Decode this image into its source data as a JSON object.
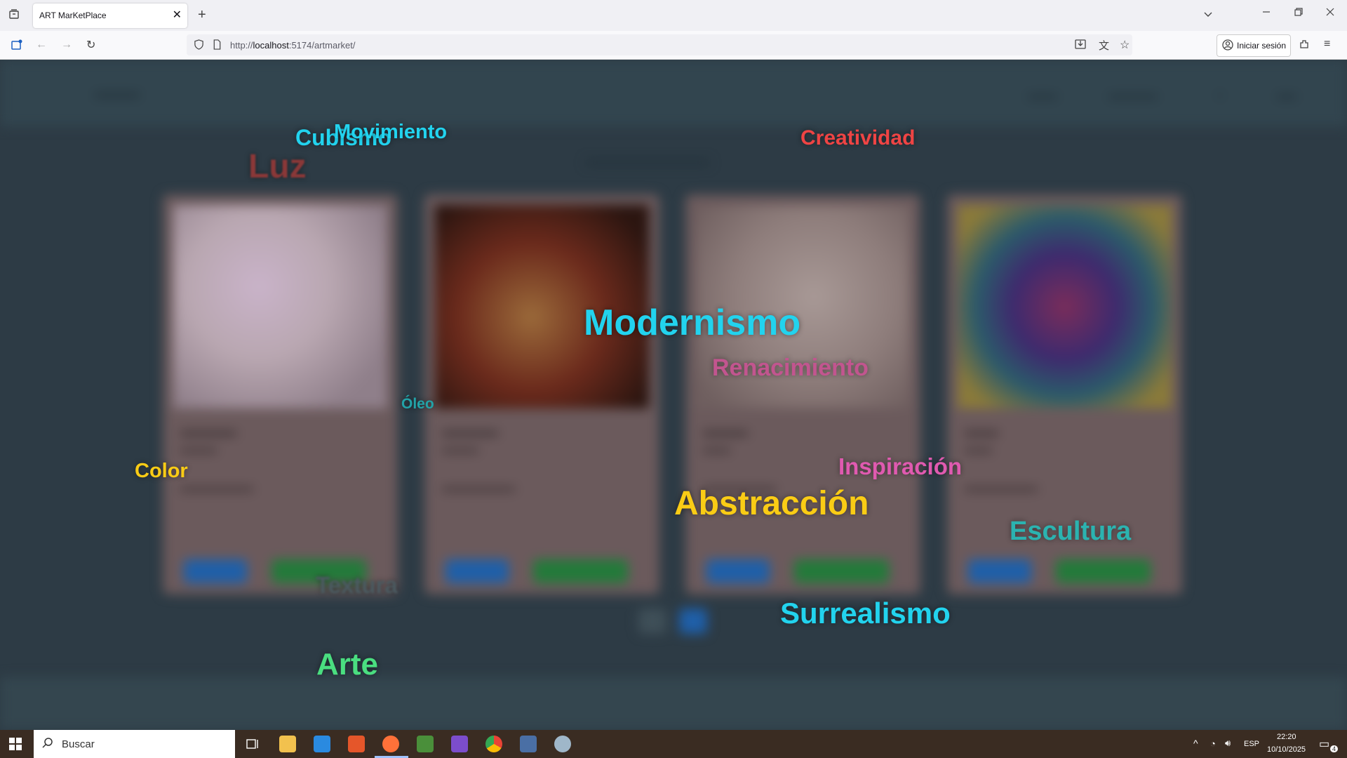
{
  "browser": {
    "tab_title": "ART MarKetPlace",
    "url_prefix": "http://",
    "url_host": "localhost",
    "url_path": ":5174/artmarket/",
    "signin_label": "Iniciar sesión"
  },
  "floating_words": [
    {
      "text": "Cubismo",
      "color": "#22d3ee"
    },
    {
      "text": "Movimiento",
      "color": "#22d3ee"
    },
    {
      "text": "Luz",
      "color": "#8a3838"
    },
    {
      "text": "Creatividad",
      "color": "#ef4444"
    },
    {
      "text": "Modernismo",
      "color": "#22d3ee"
    },
    {
      "text": "Renacimiento",
      "color": "#c2558f"
    },
    {
      "text": "Óleo",
      "color": "#22a3a8"
    },
    {
      "text": "Color",
      "color": "#facc15"
    },
    {
      "text": "Inspiración",
      "color": "#e05ab0"
    },
    {
      "text": "Abstracción",
      "color": "#facc15"
    },
    {
      "text": "Escultura",
      "color": "#2bb3b0"
    },
    {
      "text": "Textura",
      "color": "#4b5a60"
    },
    {
      "text": "Surrealismo",
      "color": "#22d3ee"
    },
    {
      "text": "Arte",
      "color": "#4ade80"
    }
  ],
  "taskbar": {
    "search_placeholder": "Buscar",
    "lang": "ESP",
    "time": "22:20",
    "date": "10/10/2025",
    "notifications": "4"
  }
}
